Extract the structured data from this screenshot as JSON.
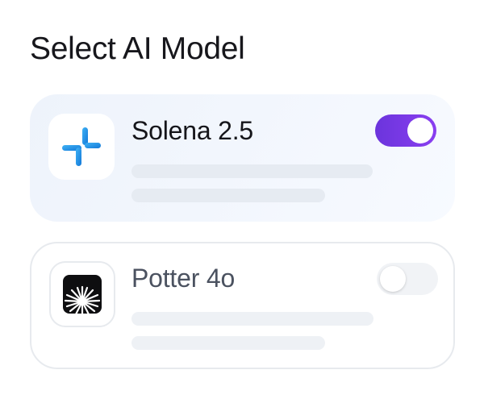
{
  "title": "Select AI Model",
  "models": [
    {
      "name": "Solena 2.5",
      "icon": "plus-cross-logo-icon",
      "enabled": true,
      "accent": "#1a8fe8"
    },
    {
      "name": "Potter 4o",
      "icon": "starburst-logo-icon",
      "enabled": false,
      "accent": "#111111"
    }
  ],
  "colors": {
    "toggle_on": "#7a3ae8",
    "toggle_off": "#f1f3f6",
    "card_active_bg": "#f0f5fc",
    "card_border": "#e7eaee"
  }
}
